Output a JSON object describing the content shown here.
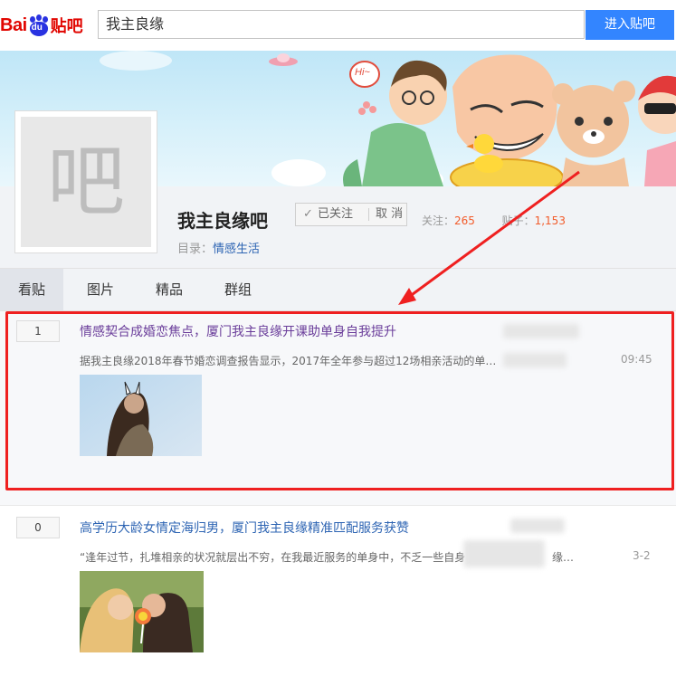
{
  "header": {
    "logo_bai": "Bai",
    "logo_du": "du",
    "logo_tieba": "贴吧",
    "search_value": "我主良缘",
    "search_button": "进入贴吧"
  },
  "forum": {
    "avatar_char": "吧",
    "name": "我主良缘吧",
    "follow_check": "✓",
    "follow_label": "已关注",
    "unfollow_label": "取 消",
    "followers_label": "关注：",
    "followers_value": "265",
    "posts_label": "贴子：",
    "posts_value": "1,153",
    "category_label": "目录：",
    "category_value": "情感生活"
  },
  "tabs": [
    {
      "label": "看贴",
      "active": true
    },
    {
      "label": "图片",
      "active": false
    },
    {
      "label": "精品",
      "active": false
    },
    {
      "label": "群组",
      "active": false
    }
  ],
  "posts": [
    {
      "reply_count": "1",
      "title": "情感契合成婚恋焦点，厦门我主良缘开课助单身自我提升",
      "abstract": "据我主良缘2018年春节婚恋调查报告显示，2017年全年参与超过12场相亲活动的单…",
      "time": "09:45",
      "highlighted": true
    },
    {
      "reply_count": "0",
      "title": "高学历大龄女情定海归男，厦门我主良缘精准匹配服务获赞",
      "abstract": "“逢年过节，扎堆相亲的状况就层出不穷，在我最近服务的单身中，不乏一些自身",
      "time_partial": "缘…",
      "time": "3-2",
      "highlighted": false
    }
  ],
  "banner": {
    "speech": "Hi~"
  },
  "colors": {
    "accent_blue": "#3385ff",
    "link_blue": "#2d64b3",
    "highlight_red": "#ef2020",
    "stat_orange": "#f25c2b"
  }
}
